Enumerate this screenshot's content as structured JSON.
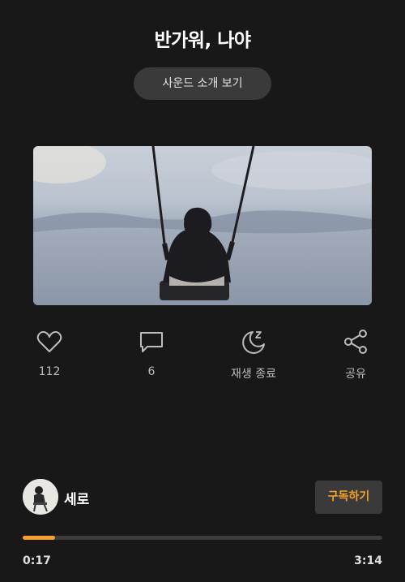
{
  "title": "반가워, 나야",
  "intro_button": "사운드 소개 보기",
  "cover": {
    "description_icon": "swing-silhouette-photo"
  },
  "actions": [
    {
      "icon": "heart-icon",
      "label": "112"
    },
    {
      "icon": "comment-icon",
      "label": "6"
    },
    {
      "icon": "sleep-timer-icon",
      "label": "재생 종료"
    },
    {
      "icon": "share-icon",
      "label": "공유"
    }
  ],
  "artist": {
    "name": "세로",
    "subscribe_label": "구독하기"
  },
  "player": {
    "current_time": "0:17",
    "total_time": "3:14",
    "progress_fraction": 0.09
  },
  "colors": {
    "background": "#181818",
    "accent": "#f5a02c",
    "button_bg": "#3a3a3a",
    "icon_gray": "#bdbdbd"
  }
}
